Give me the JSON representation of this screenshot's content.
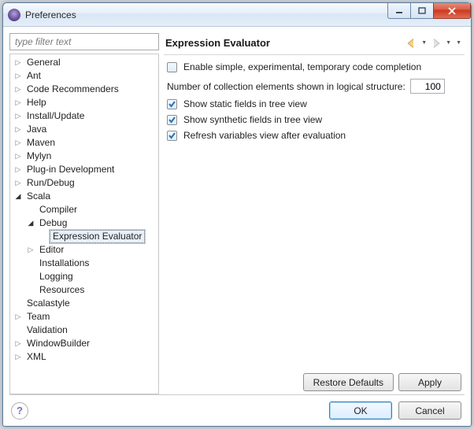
{
  "window": {
    "title": "Preferences"
  },
  "filter": {
    "placeholder": "type filter text"
  },
  "tree": {
    "general": "General",
    "ant": "Ant",
    "code_recommenders": "Code Recommenders",
    "help": "Help",
    "install_update": "Install/Update",
    "java": "Java",
    "maven": "Maven",
    "mylyn": "Mylyn",
    "plugin_dev": "Plug-in Development",
    "run_debug": "Run/Debug",
    "scala": "Scala",
    "scala_items": {
      "compiler": "Compiler",
      "debug": "Debug",
      "expr_eval": "Expression Evaluator",
      "editor": "Editor",
      "installations": "Installations",
      "logging": "Logging",
      "resources": "Resources"
    },
    "scalastyle": "Scalastyle",
    "team": "Team",
    "validation": "Validation",
    "windowbuilder": "WindowBuilder",
    "xml": "XML"
  },
  "page": {
    "title": "Expression Evaluator",
    "enable_completion": {
      "label": "Enable simple, experimental, temporary code completion",
      "checked": false
    },
    "num_elements": {
      "label": "Number of collection elements shown in logical structure:",
      "value": "100"
    },
    "show_static": {
      "label": "Show static fields in tree view",
      "checked": true
    },
    "show_synthetic": {
      "label": "Show synthetic fields in tree view",
      "checked": true
    },
    "refresh_vars": {
      "label": "Refresh variables view after evaluation",
      "checked": true
    },
    "restore_defaults": "Restore Defaults",
    "apply": "Apply"
  },
  "buttons": {
    "ok": "OK",
    "cancel": "Cancel"
  }
}
